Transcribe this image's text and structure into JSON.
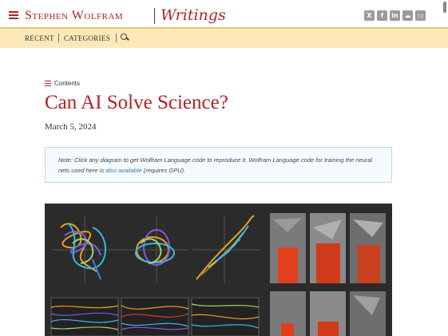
{
  "header": {
    "brand": "Stephen Wolfram",
    "section": "Writings",
    "social_icons": [
      "x-icon",
      "facebook-icon",
      "linkedin-icon",
      "soundcloud-icon",
      "chat-icon"
    ],
    "accent_color": "#b12226"
  },
  "subnav": {
    "recent": "RECENT",
    "categories": "CATEGORIES"
  },
  "article": {
    "contents_label": "Contents",
    "title": "Can AI Solve Science?",
    "date": "March 5, 2024",
    "note_prefix": "Note: Click any diagram to get Wolfram Language code to reproduce it. Wolfram Language code for training the neural nets used here is ",
    "note_link": "also available",
    "note_suffix": " (requires GPU)."
  }
}
